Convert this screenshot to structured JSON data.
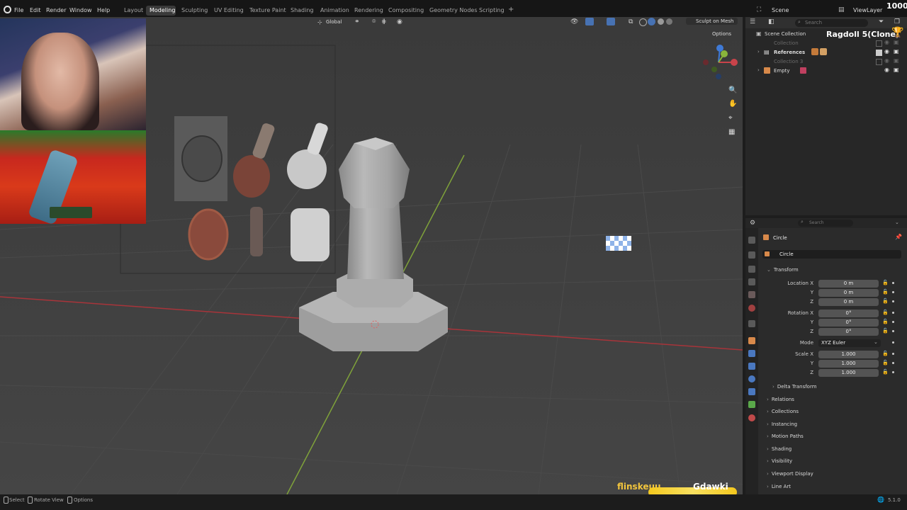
{
  "menu": [
    "File",
    "Edit",
    "Render",
    "Window",
    "Help"
  ],
  "workspaces": [
    "Layout",
    "Modeling",
    "Sculpting",
    "UV Editing",
    "Texture Paint",
    "Shading",
    "Animation",
    "Rendering",
    "Compositing",
    "Geometry Nodes",
    "Scripting"
  ],
  "active_workspace": "Modeling",
  "scene": "Scene",
  "view_layer": "ViewLayer",
  "overlay_counter": "1000",
  "viewport": {
    "orientation": "Global",
    "sculpt_on_mesh": "Sculpt on Mesh",
    "options": "Options",
    "gizmo_labels": {
      "z": "Z",
      "y": "Y",
      "x": "X"
    }
  },
  "outliner": {
    "search_placeholder": "Search",
    "root": "Scene Collection",
    "overlay_title": "Ragdoll 5(Clone)",
    "items": [
      {
        "label": "Collection",
        "dim": true
      },
      {
        "label": "References",
        "dim": false
      },
      {
        "label": "Collection 3",
        "dim": true
      },
      {
        "label": "Empty",
        "dim": false
      }
    ]
  },
  "properties": {
    "search_placeholder": "Search",
    "object_name": "Circle",
    "object_data": "Circle",
    "transform_title": "Transform",
    "location": {
      "label_x": "Location X",
      "x": "0 m",
      "y": "0 m",
      "z": "0 m"
    },
    "rotation": {
      "label_x": "Rotation X",
      "x": "0°",
      "y": "0°",
      "z": "0°"
    },
    "mode_label": "Mode",
    "mode_value": "XYZ Euler",
    "scale": {
      "label_x": "Scale X",
      "x": "1.000",
      "y": "1.000",
      "z": "1.000"
    },
    "axis_y": "Y",
    "axis_z": "Z",
    "sections": [
      "Delta Transform",
      "Relations",
      "Collections",
      "Instancing",
      "Motion Paths",
      "Shading",
      "Visibility",
      "Viewport Display",
      "Line Art"
    ]
  },
  "status": {
    "select": "Select",
    "rotate_view": "Rotate View",
    "options": "Options",
    "version": "5.1.0"
  },
  "stream_overlay": {
    "left_name": "flinskeuu",
    "right_name": "Gdawki"
  },
  "colors": {
    "accent": "#4772b3",
    "x_axis": "#c9434a",
    "y_axis": "#8ab43b",
    "z_axis": "#3f7ad6",
    "trophy": "#e8b339"
  }
}
